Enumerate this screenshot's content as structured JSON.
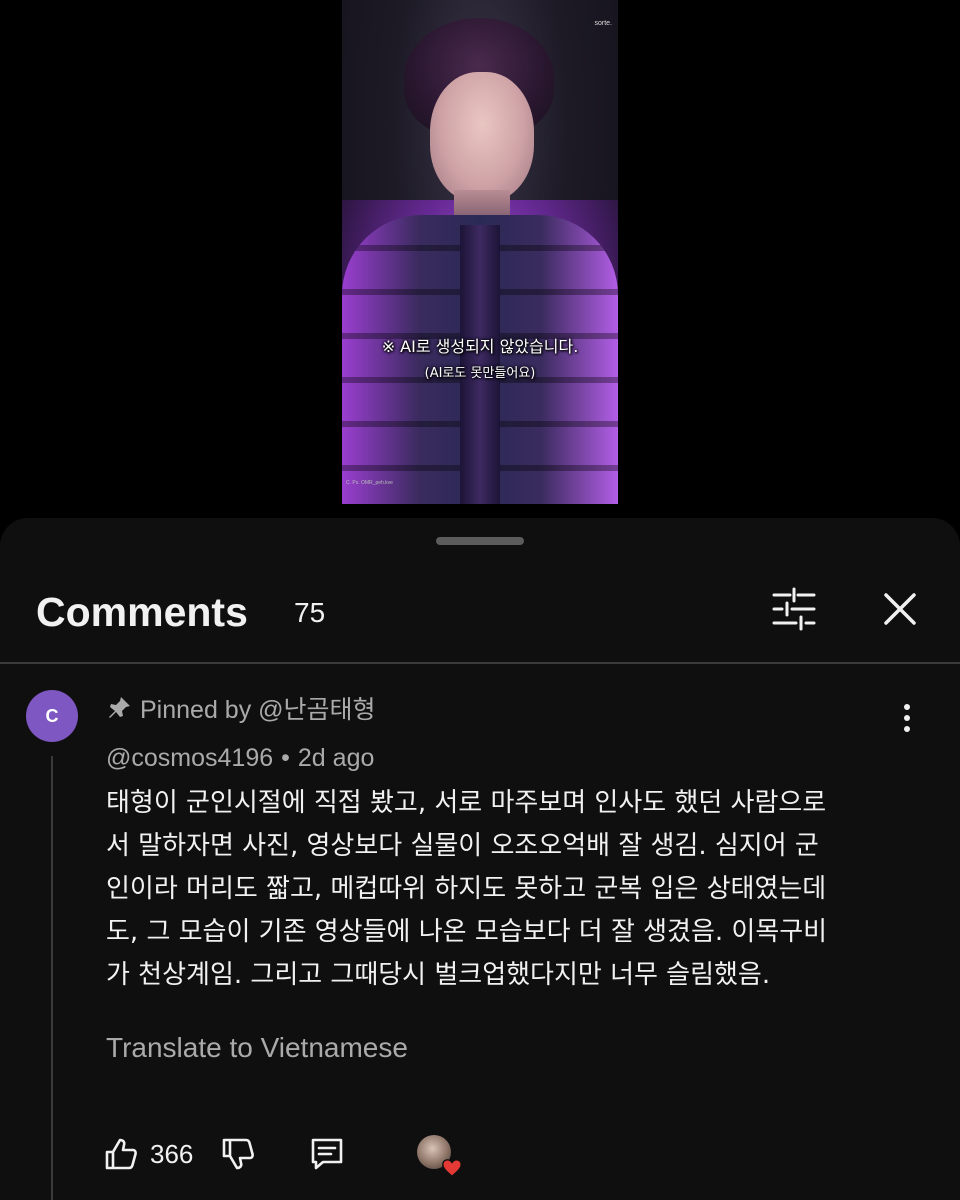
{
  "video": {
    "watermark": "sorte.",
    "caption_main": "※ AI로 생성되지 않았습니다.",
    "caption_sub": "(AI로도 못만들어요)",
    "small_credit": "C. Ps. OMR_peh.kve"
  },
  "comments": {
    "title": "Comments",
    "count": "75",
    "filter_icon": "sliders-icon",
    "close_icon": "close-icon"
  },
  "comment": {
    "avatar_letter": "C",
    "avatar_color": "#7e57c2",
    "pinned_text": "Pinned by @난곰태형",
    "author": "@cosmos4196",
    "separator": "•",
    "time": "2d ago",
    "lines": [
      "태형이 군인시절에 직접 봤고, 서로 마주보며 인사도 했던 사람으로",
      "서 말하자면 사진, 영상보다 실물이 오조오억배 잘 생김. 심지어 군",
      "인이라 머리도 짧고, 메컵따위 하지도 못하고 군복 입은 상태였는데",
      "도, 그 모습이 기존 영상들에 나온 모습보다 더 잘 생겼음. 이목구비",
      "가 천상계임. 그리고 그때당시 벌크업했다지만 너무 슬림했음."
    ],
    "translate_label": "Translate to Vietnamese",
    "like_count": "366",
    "heart_color": "#e53935"
  }
}
